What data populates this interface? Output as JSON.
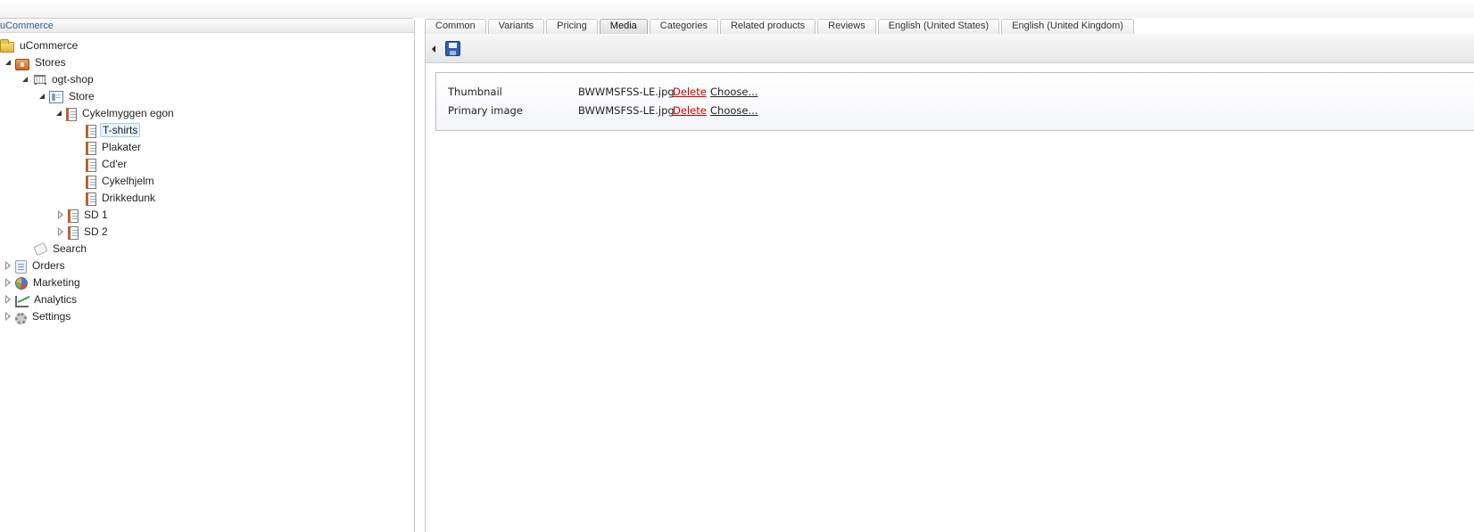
{
  "tree": {
    "panel_title": "uCommerce",
    "nodes": [
      {
        "label": "uCommerce",
        "icon": "folder-icon"
      },
      {
        "label": "Stores",
        "icon": "store-icon"
      },
      {
        "label": "ogt-shop",
        "icon": "cart-icon"
      },
      {
        "label": "Store",
        "icon": "page-icon"
      },
      {
        "label": "Cykelmyggen egon",
        "icon": "catalog-icon"
      },
      {
        "label": "T-shirts",
        "icon": "catalog-icon"
      },
      {
        "label": "Plakater",
        "icon": "catalog-icon"
      },
      {
        "label": "Cd'er",
        "icon": "catalog-icon"
      },
      {
        "label": "Cykelhjelm",
        "icon": "catalog-icon"
      },
      {
        "label": "Drikkedunk",
        "icon": "catalog-icon"
      },
      {
        "label": "SD 1",
        "icon": "catalog-icon"
      },
      {
        "label": "SD 2",
        "icon": "catalog-icon"
      },
      {
        "label": "Search",
        "icon": "search-icon"
      },
      {
        "label": "Orders",
        "icon": "orders-icon"
      },
      {
        "label": "Marketing",
        "icon": "marketing-icon"
      },
      {
        "label": "Analytics",
        "icon": "analytics-icon"
      },
      {
        "label": "Settings",
        "icon": "settings-icon"
      }
    ],
    "selected": "T-shirts"
  },
  "tabs": [
    {
      "label": "Common"
    },
    {
      "label": "Variants"
    },
    {
      "label": "Pricing"
    },
    {
      "label": "Media"
    },
    {
      "label": "Categories"
    },
    {
      "label": "Related products"
    },
    {
      "label": "Reviews"
    },
    {
      "label": "English (United States)"
    },
    {
      "label": "English (United Kingdom)"
    }
  ],
  "active_tab": "Media",
  "toolbar": {
    "icons": [
      "collapse-arrow-icon",
      "save-icon"
    ]
  },
  "media": {
    "rows": [
      {
        "label": "Thumbnail",
        "file": "BWWMSFSS-LE.jpg",
        "delete": "Delete",
        "choose": "Choose..."
      },
      {
        "label": "Primary image",
        "file": "BWWMSFSS-LE.jpg",
        "delete": "Delete",
        "choose": "Choose..."
      }
    ]
  },
  "colors": {
    "delete_link": "#cc0000",
    "panel_title": "#2f5f8a",
    "selected_bg": "#e6f3fb"
  }
}
